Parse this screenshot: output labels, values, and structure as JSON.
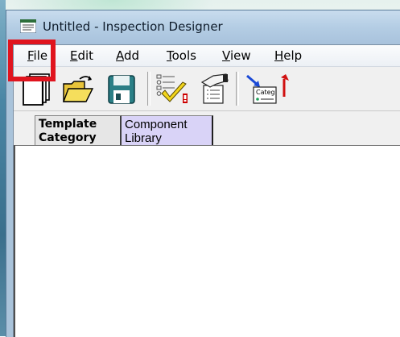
{
  "window": {
    "title": "Untitled - Inspection Designer"
  },
  "menubar": {
    "items": [
      {
        "label": "File",
        "key": "F",
        "rest": "ile"
      },
      {
        "label": "Edit",
        "key": "E",
        "rest": "dit"
      },
      {
        "label": "Add",
        "key": "A",
        "rest": "dd"
      },
      {
        "label": "Tools",
        "key": "T",
        "rest": "ools"
      },
      {
        "label": "View",
        "key": "V",
        "rest": "iew"
      },
      {
        "label": "Help",
        "key": "H",
        "rest": "elp"
      }
    ]
  },
  "toolbar": {
    "buttons": [
      "new-document-icon",
      "open-folder-icon",
      "save-disk-icon",
      "validate-checklist-icon",
      "edit-form-icon",
      "add-category-icon"
    ],
    "category_label": "Categ"
  },
  "tabs": {
    "template_category": {
      "line1": "Template",
      "line2": "Category"
    },
    "component_library": {
      "line1": "Component",
      "line2": "Library"
    }
  },
  "colors": {
    "highlight": "#e0141e",
    "component_tab": "#d9d3f7",
    "titlebar": "#b4cde4"
  }
}
